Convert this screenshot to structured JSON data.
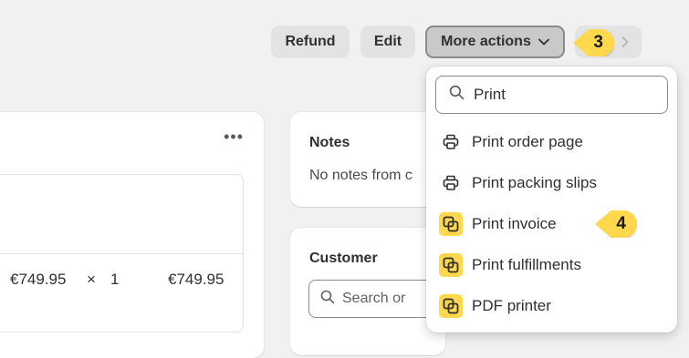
{
  "header": {
    "refund_label": "Refund",
    "edit_label": "Edit",
    "more_actions_label": "More actions",
    "next_icon": "chevron-right-icon"
  },
  "annotations": {
    "step_a": "3",
    "step_b": "4",
    "marker_color": "#ffd84d"
  },
  "order_card": {
    "line_item": {
      "price": "€749.95",
      "times": "×",
      "quantity": "1",
      "total": "€749.95"
    }
  },
  "notes_card": {
    "title": "Notes",
    "text": "No notes from c"
  },
  "customer_card": {
    "title": "Customer",
    "search_placeholder": "Search or"
  },
  "dropdown": {
    "search_value": "Print",
    "items": [
      {
        "label": "Print order page",
        "icon": "printer-icon"
      },
      {
        "label": "Print packing slips",
        "icon": "printer-icon"
      },
      {
        "label": "Print invoice",
        "icon": "app-icon"
      },
      {
        "label": "Print fulfillments",
        "icon": "app-icon"
      },
      {
        "label": "PDF printer",
        "icon": "app-icon"
      }
    ]
  }
}
